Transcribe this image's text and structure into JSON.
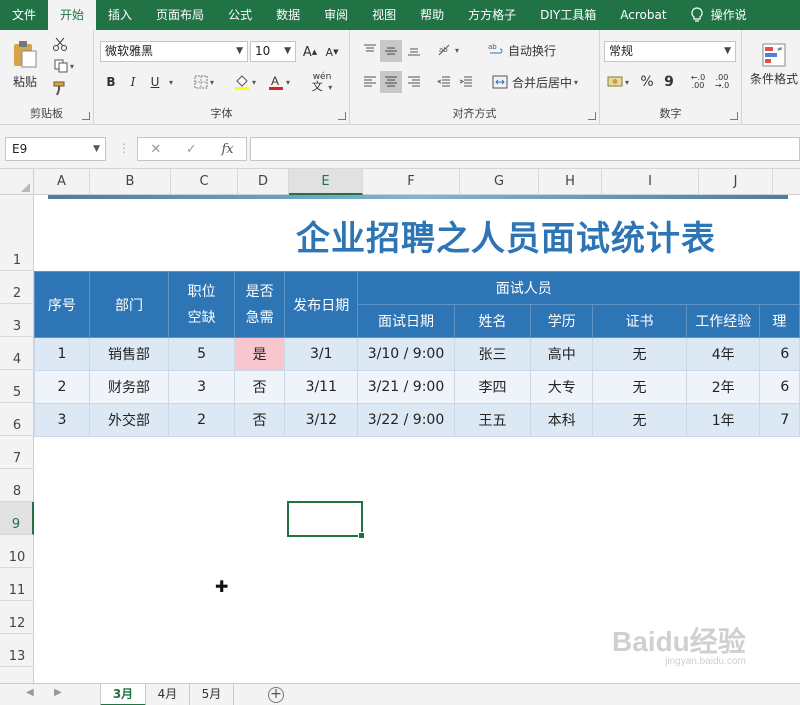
{
  "ribbon_tabs": [
    "文件",
    "开始",
    "插入",
    "页面布局",
    "公式",
    "数据",
    "审阅",
    "视图",
    "帮助",
    "方方格子",
    "DIY工具箱",
    "Acrobat",
    "操作说"
  ],
  "clipboard": {
    "paste": "粘贴",
    "label": "剪贴板"
  },
  "font": {
    "name": "微软雅黑",
    "size": "10",
    "bold": "B",
    "italic": "I",
    "underline": "U",
    "wen": "wén",
    "label": "字体"
  },
  "alignment": {
    "wrap": "自动换行",
    "merge": "合并后居中",
    "label": "对齐方式"
  },
  "number": {
    "format": "常规",
    "percent": "%",
    "comma": "9",
    "label": "数字"
  },
  "styles": {
    "conditional": "条件格式"
  },
  "formula_bar": {
    "name_box": "E9",
    "fx": "fx"
  },
  "columns": [
    "A",
    "B",
    "C",
    "D",
    "E",
    "F",
    "G",
    "H",
    "I",
    "J"
  ],
  "rows": [
    "1",
    "2",
    "3",
    "4",
    "5",
    "6",
    "7",
    "8",
    "9",
    "10",
    "11",
    "12",
    "13"
  ],
  "sheet": {
    "title": "企业招聘之人员面试统计表",
    "header": {
      "seq": "序号",
      "dept": "部门",
      "post": "职位空缺",
      "urgent": "是否急需",
      "publish": "发布日期",
      "interviewees": "面试人员",
      "interview_date": "面试日期",
      "name": "姓名",
      "edu": "学历",
      "cert": "证书",
      "experience": "工作经验",
      "cut": "理"
    },
    "records": [
      {
        "seq": "1",
        "dept": "销售部",
        "post": "5",
        "urgent": "是",
        "publish": "3/1",
        "date": "3/10 / 9:00",
        "name": "张三",
        "edu": "高中",
        "cert": "无",
        "exp": "4年",
        "cut": "6"
      },
      {
        "seq": "2",
        "dept": "财务部",
        "post": "3",
        "urgent": "否",
        "publish": "3/11",
        "date": "3/21 / 9:00",
        "name": "李四",
        "edu": "大专",
        "cert": "无",
        "exp": "2年",
        "cut": "6"
      },
      {
        "seq": "3",
        "dept": "外交部",
        "post": "2",
        "urgent": "否",
        "publish": "3/12",
        "date": "3/22 / 9:00",
        "name": "王五",
        "edu": "本科",
        "cert": "无",
        "exp": "1年",
        "cut": "7"
      }
    ]
  },
  "sheet_tabs": [
    "3月",
    "4月",
    "5月"
  ],
  "watermark": {
    "brand": "Baidu经验",
    "url": "jingyan.baidu.com"
  },
  "colors": {
    "excel_green": "#217346",
    "header_blue": "#2e75b6",
    "row_light": "#dce9f5",
    "urgent_pink": "#f8c7ce"
  }
}
